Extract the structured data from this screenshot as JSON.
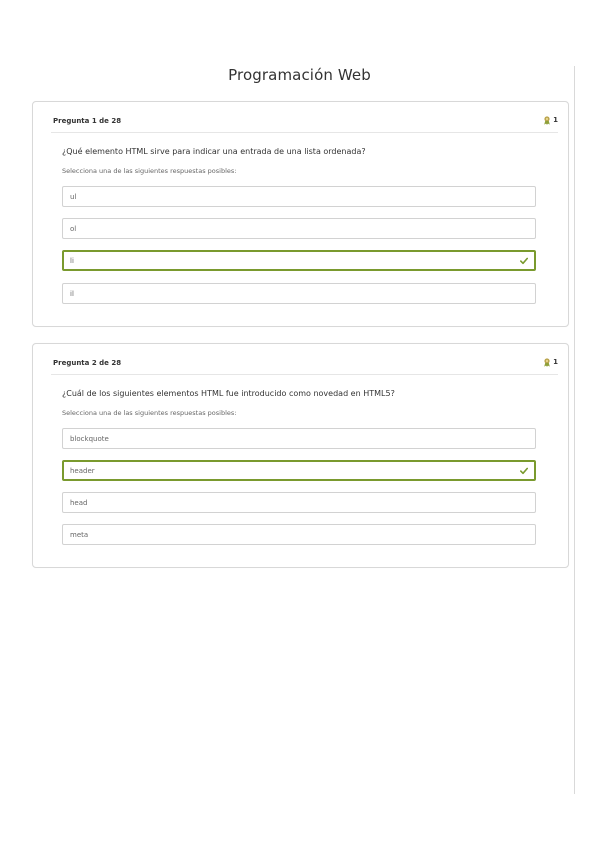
{
  "page": {
    "title": "Programación Web"
  },
  "colors": {
    "accent_green": "#7a9a2e",
    "points_icon": "#b8a24a",
    "border": "#d2d2d2"
  },
  "questions": [
    {
      "header": "Pregunta 1 de 28",
      "points": "1",
      "points_icon": "award-icon",
      "text": "¿Qué elemento HTML sirve para indicar una entrada de una lista ordenada?",
      "instructions": "Selecciona una de las siguientes respuestas posibles:",
      "answers": [
        {
          "label": "ul",
          "selected": false
        },
        {
          "label": "ol",
          "selected": false
        },
        {
          "label": "li",
          "selected": true
        },
        {
          "label": "il",
          "selected": false
        }
      ]
    },
    {
      "header": "Pregunta 2 de 28",
      "points": "1",
      "points_icon": "award-icon",
      "text": "¿Cuál de los siguientes elementos HTML fue introducido como novedad en HTML5?",
      "instructions": "Selecciona una de las siguientes respuestas posibles:",
      "answers": [
        {
          "label": "blockquote",
          "selected": false
        },
        {
          "label": "header",
          "selected": true
        },
        {
          "label": "head",
          "selected": false
        },
        {
          "label": "meta",
          "selected": false
        }
      ]
    }
  ]
}
